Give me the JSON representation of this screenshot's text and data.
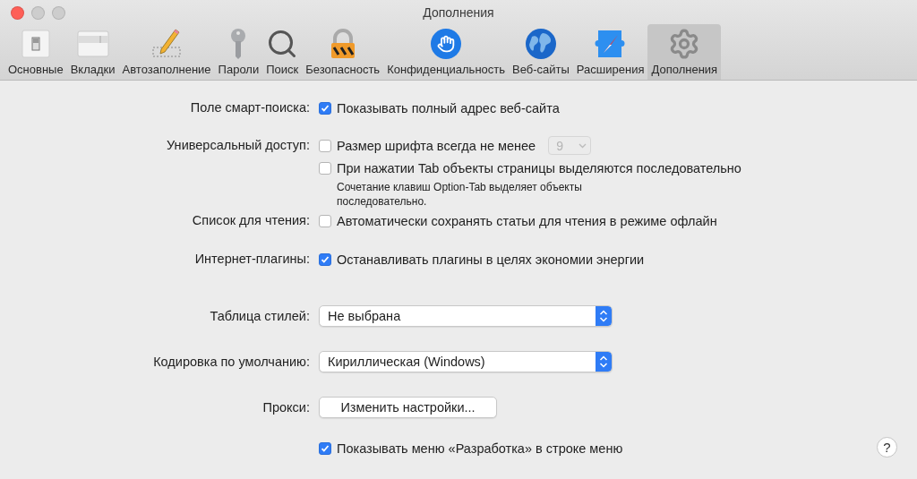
{
  "window": {
    "title": "Дополнения"
  },
  "tabs": [
    {
      "label": "Основные",
      "selected": false
    },
    {
      "label": "Вкладки",
      "selected": false
    },
    {
      "label": "Автозаполнение",
      "selected": false
    },
    {
      "label": "Пароли",
      "selected": false
    },
    {
      "label": "Поиск",
      "selected": false
    },
    {
      "label": "Безопасность",
      "selected": false
    },
    {
      "label": "Конфиденциальность",
      "selected": false
    },
    {
      "label": "Веб-сайты",
      "selected": false
    },
    {
      "label": "Расширения",
      "selected": false
    },
    {
      "label": "Дополнения",
      "selected": true
    }
  ],
  "settings": [
    {
      "label": "Поле смарт-поиска:",
      "controls": [
        {
          "kind": "checkbox",
          "text": "Показывать полный адрес веб-сайта",
          "checked": true
        }
      ]
    },
    {
      "label": "Универсальный доступ:",
      "controls": [
        {
          "kind": "checkbox",
          "text": "Размер шрифта всегда не менее",
          "checked": false,
          "select": {
            "value": "9",
            "disabled": true
          }
        },
        {
          "kind": "checkbox",
          "text": "При нажатии Tab объекты страницы выделяются последовательно",
          "checked": false
        },
        {
          "kind": "hint",
          "text": "Сочетание клавиш Option-Tab выделяет объекты последовательно."
        }
      ]
    },
    {
      "label": "Список для чтения:",
      "controls": [
        {
          "kind": "checkbox",
          "text": "Автоматически сохранять статьи для чтения в режиме офлайн",
          "checked": false
        }
      ]
    },
    {
      "label": "Интернет-плагины:",
      "controls": [
        {
          "kind": "checkbox",
          "text": "Останавливать плагины в целях экономии энергии",
          "checked": true
        }
      ]
    },
    {
      "label": "Таблица стилей:",
      "controls": [
        {
          "kind": "popup",
          "value": "Не выбрана"
        }
      ]
    },
    {
      "label": "Кодировка по умолчанию:",
      "controls": [
        {
          "kind": "popup",
          "value": "Кириллическая (Windows)"
        }
      ]
    },
    {
      "label": "Прокси:",
      "controls": [
        {
          "kind": "button",
          "text": "Изменить настройки..."
        }
      ]
    },
    {
      "controls": [
        {
          "kind": "checkbox",
          "text": "Показывать меню «Разработка» в строке меню",
          "checked": true
        }
      ]
    }
  ],
  "help": {
    "text": "?"
  }
}
